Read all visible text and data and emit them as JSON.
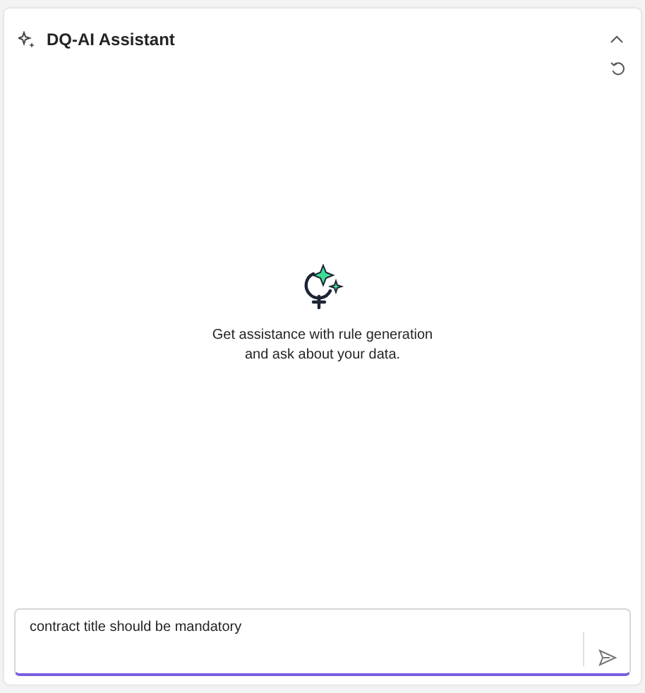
{
  "panel": {
    "title": "DQ-AI Assistant",
    "expanded": true
  },
  "empty_state": {
    "message": "Get assistance with rule generation and ask about your data."
  },
  "prompt": {
    "value": "contract title should be mandatory"
  }
}
